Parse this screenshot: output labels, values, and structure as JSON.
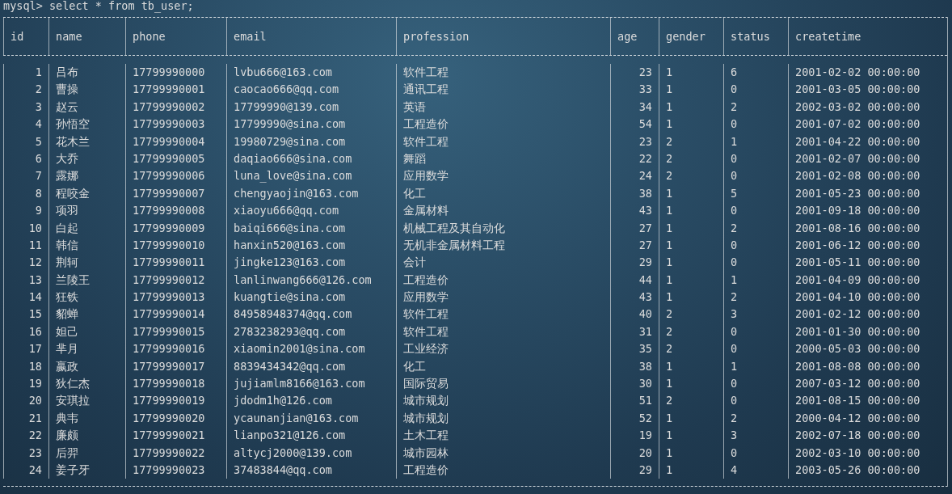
{
  "prompt": "mysql> select * from tb_user;",
  "table": {
    "columns": [
      "id",
      "name",
      "phone",
      "email",
      "profession",
      "age",
      "gender",
      "status",
      "createtime"
    ],
    "rows": [
      [
        "1",
        "吕布",
        "17799990000",
        "lvbu666@163.com",
        "软件工程",
        "23",
        "1",
        "6",
        "2001-02-02 00:00:00"
      ],
      [
        "2",
        "曹操",
        "17799990001",
        "caocao666@qq.com",
        "通讯工程",
        "33",
        "1",
        "0",
        "2001-03-05 00:00:00"
      ],
      [
        "3",
        "赵云",
        "17799990002",
        "17799990@139.com",
        "英语",
        "34",
        "1",
        "2",
        "2002-03-02 00:00:00"
      ],
      [
        "4",
        "孙悟空",
        "17799990003",
        "17799990@sina.com",
        "工程造价",
        "54",
        "1",
        "0",
        "2001-07-02 00:00:00"
      ],
      [
        "5",
        "花木兰",
        "17799990004",
        "19980729@sina.com",
        "软件工程",
        "23",
        "2",
        "1",
        "2001-04-22 00:00:00"
      ],
      [
        "6",
        "大乔",
        "17799990005",
        "daqiao666@sina.com",
        "舞蹈",
        "22",
        "2",
        "0",
        "2001-02-07 00:00:00"
      ],
      [
        "7",
        "露娜",
        "17799990006",
        "luna_love@sina.com",
        "应用数学",
        "24",
        "2",
        "0",
        "2001-02-08 00:00:00"
      ],
      [
        "8",
        "程咬金",
        "17799990007",
        "chengyaojin@163.com",
        "化工",
        "38",
        "1",
        "5",
        "2001-05-23 00:00:00"
      ],
      [
        "9",
        "项羽",
        "17799990008",
        "xiaoyu666@qq.com",
        "金属材料",
        "43",
        "1",
        "0",
        "2001-09-18 00:00:00"
      ],
      [
        "10",
        "白起",
        "17799990009",
        "baiqi666@sina.com",
        "机械工程及其自动化",
        "27",
        "1",
        "2",
        "2001-08-16 00:00:00"
      ],
      [
        "11",
        "韩信",
        "17799990010",
        "hanxin520@163.com",
        "无机非金属材料工程",
        "27",
        "1",
        "0",
        "2001-06-12 00:00:00"
      ],
      [
        "12",
        "荆轲",
        "17799990011",
        "jingke123@163.com",
        "会计",
        "29",
        "1",
        "0",
        "2001-05-11 00:00:00"
      ],
      [
        "13",
        "兰陵王",
        "17799990012",
        "lanlinwang666@126.com",
        "工程造价",
        "44",
        "1",
        "1",
        "2001-04-09 00:00:00"
      ],
      [
        "14",
        "狂铁",
        "17799990013",
        "kuangtie@sina.com",
        "应用数学",
        "43",
        "1",
        "2",
        "2001-04-10 00:00:00"
      ],
      [
        "15",
        "貂蝉",
        "17799990014",
        "84958948374@qq.com",
        "软件工程",
        "40",
        "2",
        "3",
        "2001-02-12 00:00:00"
      ],
      [
        "16",
        "妲己",
        "17799990015",
        "2783238293@qq.com",
        "软件工程",
        "31",
        "2",
        "0",
        "2001-01-30 00:00:00"
      ],
      [
        "17",
        "芈月",
        "17799990016",
        "xiaomin2001@sina.com",
        "工业经济",
        "35",
        "2",
        "0",
        "2000-05-03 00:00:00"
      ],
      [
        "18",
        "嬴政",
        "17799990017",
        "8839434342@qq.com",
        "化工",
        "38",
        "1",
        "1",
        "2001-08-08 00:00:00"
      ],
      [
        "19",
        "狄仁杰",
        "17799990018",
        "jujiamlm8166@163.com",
        "国际贸易",
        "30",
        "1",
        "0",
        "2007-03-12 00:00:00"
      ],
      [
        "20",
        "安琪拉",
        "17799990019",
        "jdodm1h@126.com",
        "城市规划",
        "51",
        "2",
        "0",
        "2001-08-15 00:00:00"
      ],
      [
        "21",
        "典韦",
        "17799990020",
        "ycaunanjian@163.com",
        "城市规划",
        "52",
        "1",
        "2",
        "2000-04-12 00:00:00"
      ],
      [
        "22",
        "廉颇",
        "17799990021",
        "lianpo321@126.com",
        "土木工程",
        "19",
        "1",
        "3",
        "2002-07-18 00:00:00"
      ],
      [
        "23",
        "后羿",
        "17799990022",
        "altycj2000@139.com",
        "城市园林",
        "20",
        "1",
        "0",
        "2002-03-10 00:00:00"
      ],
      [
        "24",
        "姜子牙",
        "17799990023",
        "37483844@qq.com",
        "工程造价",
        "29",
        "1",
        "4",
        "2003-05-26 00:00:00"
      ]
    ]
  }
}
